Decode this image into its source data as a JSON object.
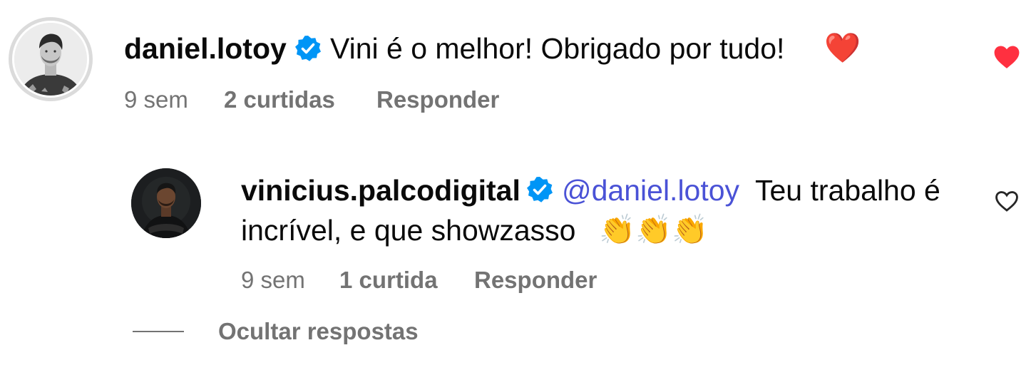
{
  "comment": {
    "username": "daniel.lotoy",
    "text": "Vini é o melhor! Obrigado por tudo!",
    "emoji": "❤️",
    "time": "9 sem",
    "likes": "2 curtidas",
    "reply_label": "Responder",
    "liked": true,
    "verified": true
  },
  "reply": {
    "username": "vinicius.palcodigital",
    "mention": "@daniel.lotoy",
    "text_line1": "Teu trabalho é",
    "text_line2": "incrível, e que showzasso",
    "emoji": "👏👏👏",
    "time": "9 sem",
    "likes": "1 curtida",
    "reply_label": "Responder",
    "liked": false,
    "verified": true
  },
  "hide_replies_label": "Ocultar respostas",
  "colors": {
    "heart_filled": "#ff3040",
    "verified_badge": "#0095f6",
    "mention": "#4a52d6",
    "secondary_text": "#737373"
  },
  "icons": [
    "verified-badge-icon",
    "heart-filled-icon",
    "heart-outline-icon"
  ]
}
